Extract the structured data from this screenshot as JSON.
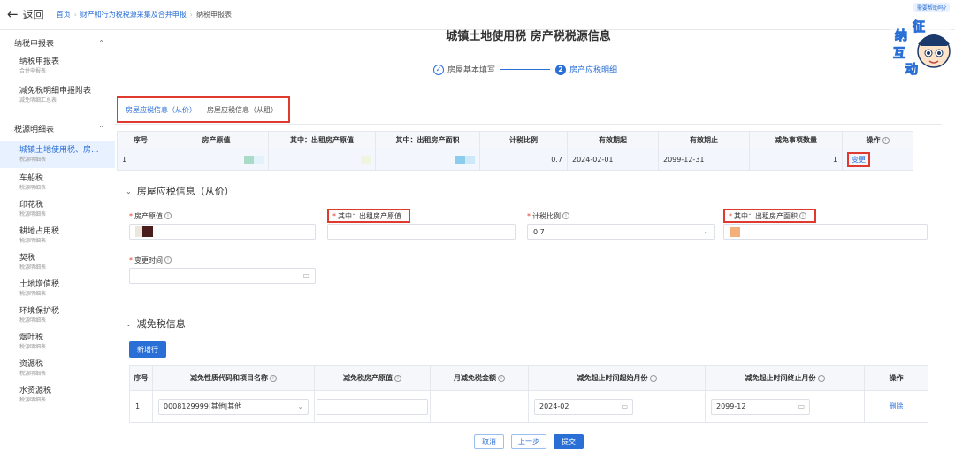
{
  "topbar": {
    "back_label": "返回",
    "breadcrumbs": [
      "首页",
      "财产和行为税税源采集及合并申报",
      "纳税申报表"
    ],
    "help_badge": "需要帮助吗?"
  },
  "sidebar": {
    "group1": "纳税申报表",
    "group1_items": [
      {
        "title": "纳税申报表",
        "sub": "合并申报表"
      },
      {
        "title": "减免税明细申报附表",
        "sub": "减免明细汇总表"
      }
    ],
    "group2": "税源明细表",
    "group2_items": [
      {
        "title": "城镇土地使用税、房...",
        "sub": "税源明细表"
      },
      {
        "title": "车船税",
        "sub": "税源明细表"
      },
      {
        "title": "印花税",
        "sub": "税源明细表"
      },
      {
        "title": "耕地占用税",
        "sub": "税源明细表"
      },
      {
        "title": "契税",
        "sub": "税源明细表"
      },
      {
        "title": "土地增值税",
        "sub": "税源明细表"
      },
      {
        "title": "环境保护税",
        "sub": "税源明细表"
      },
      {
        "title": "烟叶税",
        "sub": "税源明细表"
      },
      {
        "title": "资源税",
        "sub": "税源明细表"
      },
      {
        "title": "水资源税",
        "sub": "税源明细表"
      }
    ]
  },
  "main": {
    "title": "城镇土地使用税 房产税税源信息",
    "steps": [
      {
        "num": "✓",
        "label": "房屋基本填写"
      },
      {
        "num": "2",
        "label": "房产应税明细"
      }
    ],
    "tabs": [
      "房屋应税信息（从价）",
      "房屋应税信息（从租）"
    ]
  },
  "table1": {
    "headers": [
      "序号",
      "房产原值",
      "其中：出租房产原值",
      "其中：出租房产面积",
      "计税比例",
      "有效期起",
      "有效期止",
      "减免事项数量",
      "操作"
    ],
    "row": {
      "seq": "1",
      "ratio": "0.7",
      "start": "2024-02-01",
      "end": "2099-12-31",
      "count": "1",
      "action": "变更"
    }
  },
  "section1": {
    "title": "房屋应税信息（从价）",
    "fields": {
      "original_value_label": "房产原值",
      "rent_value_label": "其中：出租房产原值",
      "ratio_label": "计税比例",
      "ratio_value": "0.7",
      "rent_area_label": "其中：出租房产面积",
      "change_time_label": "变更时间"
    }
  },
  "section2": {
    "title": "减免税信息",
    "add_button": "新增行",
    "headers": [
      "序号",
      "减免性质代码和项目名称",
      "减免税房产原值",
      "月减免税金额",
      "减免起止时间起始月份",
      "减免起止时间终止月份",
      "操作"
    ],
    "row": {
      "seq": "1",
      "code": "0008129999|其他|其他",
      "start_month": "2024-02",
      "end_month": "2099-12",
      "action": "删除"
    }
  },
  "footer": {
    "cancel": "取消",
    "prev": "上一步",
    "submit": "提交"
  },
  "mascot": {
    "chars": [
      "纳",
      "征",
      "互",
      "动"
    ]
  },
  "colors": {
    "accent": "#2a6fd6",
    "highlight_box": "#e03a2e",
    "active_bg": "#e8f1ff"
  }
}
